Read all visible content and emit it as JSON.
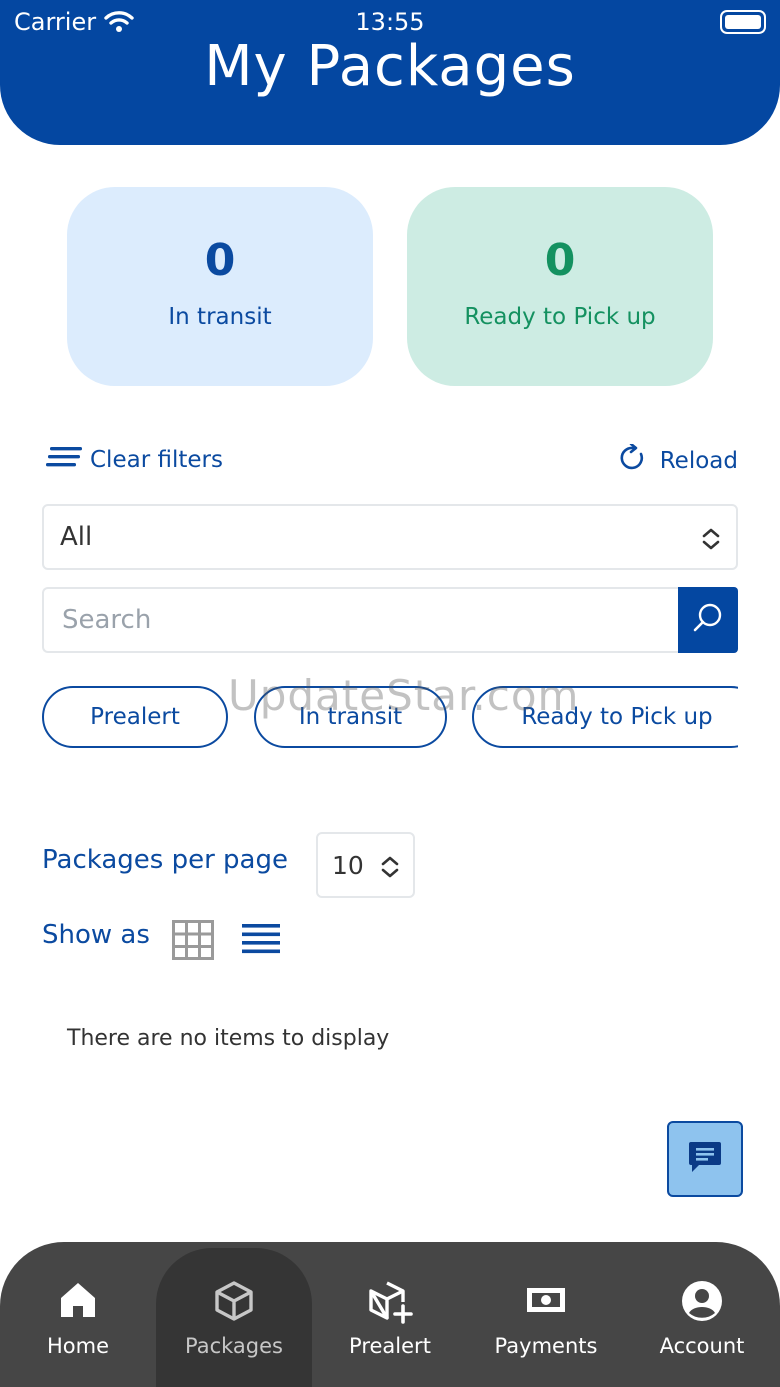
{
  "status_bar": {
    "carrier": "Carrier",
    "time": "13:55"
  },
  "header": {
    "title": "My Packages"
  },
  "stats": [
    {
      "value": "0",
      "label": "In transit",
      "color": "#0b4aa0",
      "background": "#dcecfd"
    },
    {
      "value": "0",
      "label": "Ready to Pick up",
      "color": "#149160",
      "background": "#cdece3"
    }
  ],
  "filters": {
    "clear_label": "Clear filters",
    "reload_label": "Reload"
  },
  "status_select": {
    "selected": "All"
  },
  "search": {
    "placeholder": "Search",
    "value": ""
  },
  "chips": [
    "Prealert",
    "In transit",
    "Ready to Pick up"
  ],
  "pagination": {
    "label": "Packages per page",
    "value": "10"
  },
  "view_toggle": {
    "label": "Show as",
    "options": [
      "grid-icon",
      "list-icon"
    ]
  },
  "empty_message": "There are no items to display",
  "watermark": "UpdateStar.com",
  "tabbar": {
    "items": [
      {
        "label": "Home",
        "icon": "home-icon"
      },
      {
        "label": "Packages",
        "icon": "package-icon",
        "active": true
      },
      {
        "label": "Prealert",
        "icon": "package-add-icon"
      },
      {
        "label": "Payments",
        "icon": "money-icon"
      },
      {
        "label": "Account",
        "icon": "account-icon"
      }
    ]
  },
  "colors": {
    "primary": "#0447a1",
    "ready_green": "#149160",
    "tabbar": "#464646"
  }
}
